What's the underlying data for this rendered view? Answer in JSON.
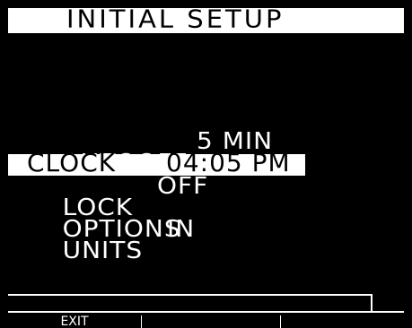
{
  "header": {
    "title": "INITIAL SETUP"
  },
  "menu": {
    "autooff": {
      "label": "AUTOOFF",
      "value": "5 MIN"
    },
    "clock": {
      "label": "CLOCK",
      "value": "04:05 PM"
    },
    "lock": {
      "label": "LOCK",
      "value": "OFF"
    },
    "options": {
      "label": "OPTIONS"
    },
    "units": {
      "label": "UNITS",
      "value": "IN"
    }
  },
  "softkeys": {
    "key1": "EXIT",
    "key2": "",
    "key3": ""
  },
  "colors": {
    "background": "#000000",
    "foreground": "#ffffff",
    "highlight_text": "#000000"
  }
}
